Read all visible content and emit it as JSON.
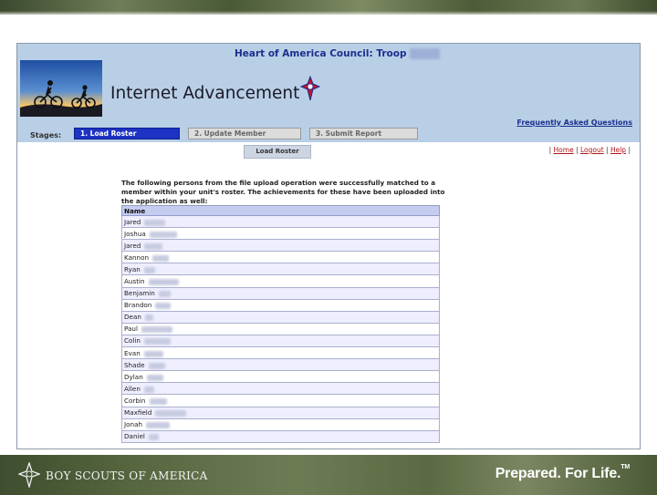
{
  "header": {
    "council_label": "Heart of America Council: Troop",
    "troop_number": "8260",
    "app_title": "Internet Advancement",
    "faq_link": "Frequently Asked Questions"
  },
  "stages": {
    "label": "Stages:",
    "items": [
      "1. Load Roster",
      "2. Update Member",
      "3. Submit Report"
    ],
    "active_index": 0
  },
  "subnav": {
    "current_tab": "Load Roster",
    "links": [
      "Home",
      "Logout",
      "Help"
    ]
  },
  "message": "The following persons from the file upload operation were successfully matched to a member within your unit's roster. The achievements for these have been uploaded into the application as well:",
  "roster": {
    "column_header": "Name",
    "rows": [
      {
        "first": "Jared",
        "last": "Mevans"
      },
      {
        "first": "Joshua",
        "last": "Adelmann"
      },
      {
        "first": "Jared",
        "last": "Baugh"
      },
      {
        "first": "Kannon",
        "last": "Evans"
      },
      {
        "first": "Ryan",
        "last": "Holt"
      },
      {
        "first": "Austin",
        "last": "Richardson"
      },
      {
        "first": "Benjamin",
        "last": "Pitts"
      },
      {
        "first": "Brandon",
        "last": "Peyer"
      },
      {
        "first": "Dean",
        "last": "Fry"
      },
      {
        "first": "Paul",
        "last": "Havemarch"
      },
      {
        "first": "Colin",
        "last": "Goodman"
      },
      {
        "first": "Evan",
        "last": "Grimes"
      },
      {
        "first": "Shade",
        "last": "Wiebe"
      },
      {
        "first": "Dylan",
        "last": "Moore"
      },
      {
        "first": "Allen",
        "last": "Ray"
      },
      {
        "first": "Corbin",
        "last": "Smyth"
      },
      {
        "first": "Maxfield",
        "last": "Langmarch"
      },
      {
        "first": "Jonah",
        "last": "Laughlin"
      },
      {
        "first": "Daniel",
        "last": "Lee"
      }
    ]
  },
  "footer": {
    "org_name": "BOY SCOUTS OF AMERICA",
    "tagline": "Prepared. For Life.",
    "trademark": "TM"
  },
  "colors": {
    "header_bg": "#b9cfe6",
    "active_stage": "#1d33c4",
    "title_link": "#1c2f8e",
    "table_header": "#c6ccf0",
    "row_alt": "#eeeeff"
  }
}
